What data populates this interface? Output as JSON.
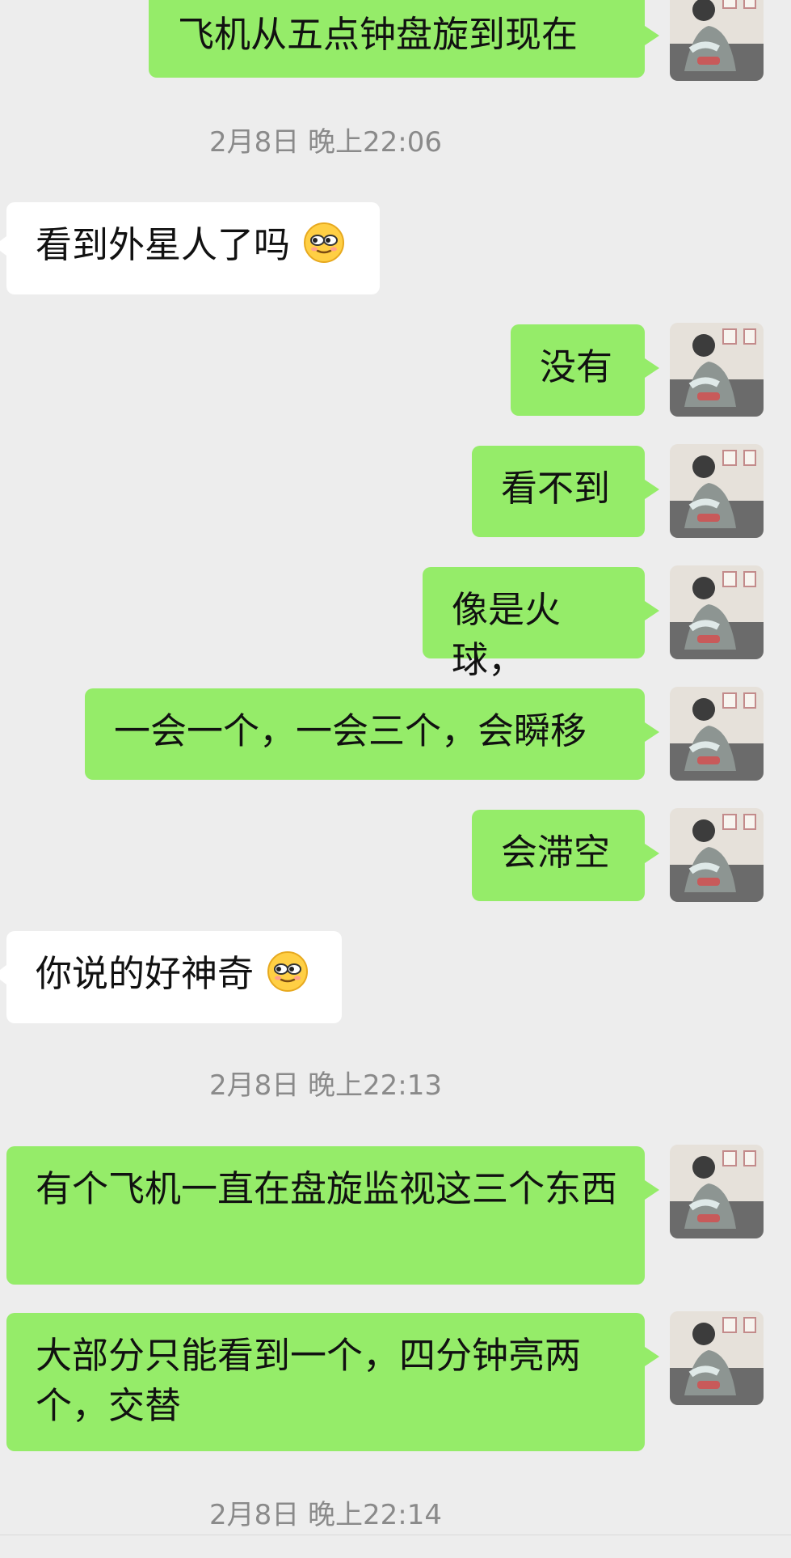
{
  "colors": {
    "background": "#ededed",
    "sent_bubble": "#95ec69",
    "received_bubble": "#ffffff",
    "timestamp_text": "#8a8a8a"
  },
  "messages": [
    {
      "type": "sent",
      "text": "飞机从五点钟盘旋到现在",
      "avatar_icon": "user-avatar-icon"
    },
    {
      "type": "timestamp",
      "text": "2月8日 晚上22:06"
    },
    {
      "type": "received",
      "text": "看到外星人了吗",
      "emoji": "smirk-emoji-icon"
    },
    {
      "type": "sent",
      "text": "没有",
      "avatar_icon": "user-avatar-icon"
    },
    {
      "type": "sent",
      "text": "看不到",
      "avatar_icon": "user-avatar-icon"
    },
    {
      "type": "sent",
      "text": "像是火球，",
      "avatar_icon": "user-avatar-icon"
    },
    {
      "type": "sent",
      "text": "一会一个，一会三个，会瞬移",
      "avatar_icon": "user-avatar-icon"
    },
    {
      "type": "sent",
      "text": "会滞空",
      "avatar_icon": "user-avatar-icon"
    },
    {
      "type": "received",
      "text": "你说的好神奇",
      "emoji": "smirk-emoji-icon"
    },
    {
      "type": "timestamp",
      "text": "2月8日 晚上22:13"
    },
    {
      "type": "sent",
      "text": "有个飞机一直在盘旋监视这三个东西",
      "avatar_icon": "user-avatar-icon"
    },
    {
      "type": "sent",
      "text": "大部分只能看到一个，四分钟亮两个，交替",
      "avatar_icon": "user-avatar-icon"
    },
    {
      "type": "timestamp",
      "text": "2月8日 晚上22:14"
    }
  ]
}
